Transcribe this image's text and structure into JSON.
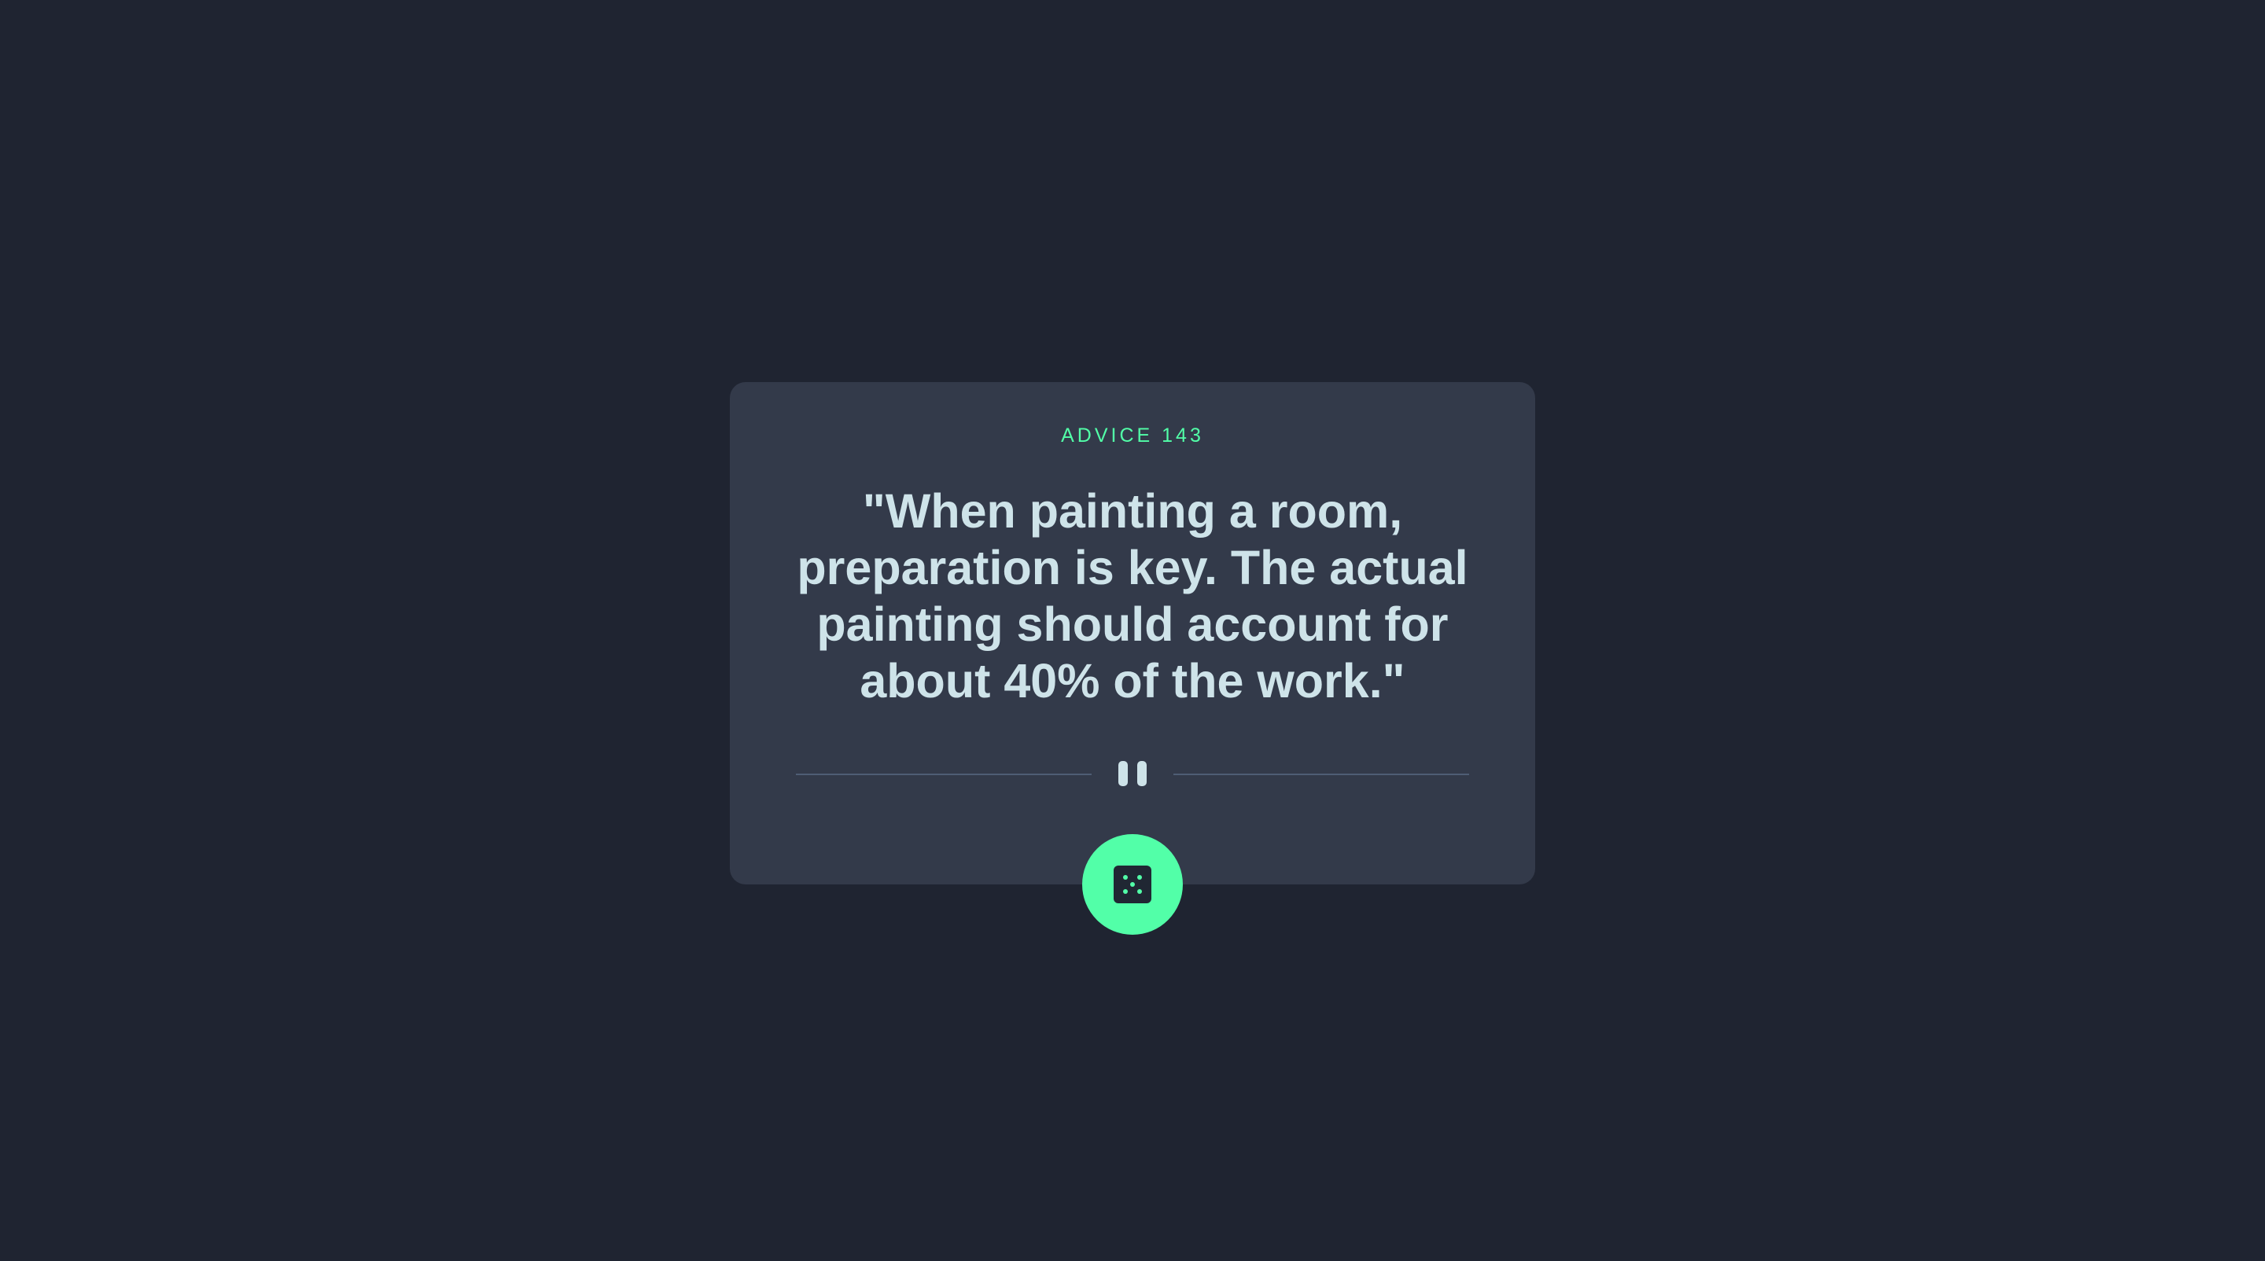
{
  "advice": {
    "heading": "ADVICE 143",
    "quote": "\"When painting a room, preparation is key. The actual painting should account for about 40% of the work.\""
  },
  "icons": {
    "divider": "pause-icon",
    "button": "dice-icon"
  },
  "colors": {
    "background": "#1f2431",
    "card": "#333a4a",
    "accent": "#52ffa8",
    "text": "#cee3e9",
    "divider": "#4f5d74"
  }
}
